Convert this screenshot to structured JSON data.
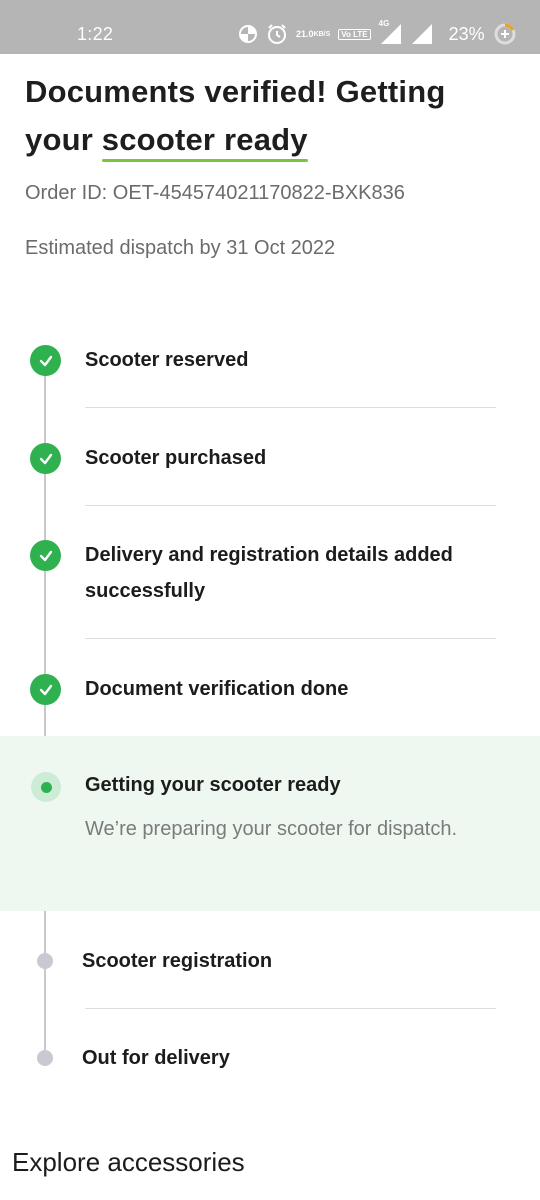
{
  "status_bar": {
    "time": "1:22",
    "speed_value": "21.0",
    "speed_unit": "KB/S",
    "network": "4G",
    "volte": "Vo LTE",
    "battery": "23%"
  },
  "header": {
    "title_line1": "Documents verified! Getting",
    "title_line2_prefix": "your ",
    "title_line2_highlight": "scooter ready",
    "order_id": "Order ID: OET-454574021170822-BXK836",
    "dispatch": "Estimated dispatch by 31 Oct 2022"
  },
  "timeline": {
    "completed": [
      {
        "label": "Scooter reserved"
      },
      {
        "label": "Scooter purchased"
      },
      {
        "label": "Delivery and registration details added successfully"
      },
      {
        "label": "Document verification done"
      }
    ],
    "active": {
      "label": "Getting your scooter ready",
      "description": "We’re preparing your scooter for dispatch."
    },
    "pending": [
      {
        "label": "Scooter registration"
      },
      {
        "label": "Out for delivery"
      }
    ]
  },
  "explore": {
    "title": "Explore accessories"
  },
  "colors": {
    "accent_green": "#2eb14e",
    "underline_green": "#7cc242",
    "active_bg": "#eef8f1",
    "pending_grey": "#c9c9d1"
  }
}
